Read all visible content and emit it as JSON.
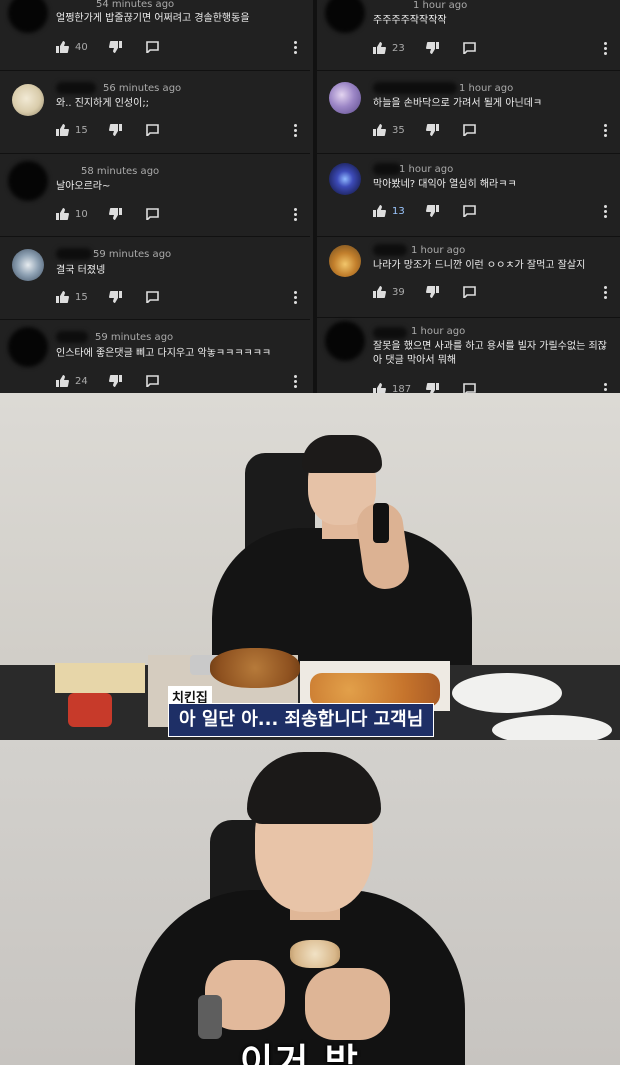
{
  "comments_left": [
    {
      "time": "54 minutes ago",
      "text": "얼쩡한가게 밥줄끊기면 어쩌려고 경솔한행동을",
      "likes": "40"
    },
    {
      "time": "56 minutes ago",
      "text": "와.. 진지하게 인성이;;",
      "likes": "15"
    },
    {
      "time": "58 minutes ago",
      "text": "날아오르라~",
      "likes": "10"
    },
    {
      "time": "59 minutes ago",
      "text": "결국 터졌넹",
      "likes": "15"
    },
    {
      "time": "59 minutes ago",
      "text": "인스타에 좋은댓글 삐고 다지우고 악놓ㅋㅋㅋㅋㅋㅋ",
      "likes": "24"
    }
  ],
  "comments_right": [
    {
      "time": "1 hour ago",
      "text": "주주주주작작작작",
      "likes": "23"
    },
    {
      "time": "1 hour ago",
      "text": "하늘을 손바닥으로 가려서 될게 아닌데ㅋ",
      "likes": "35"
    },
    {
      "time": "1 hour ago",
      "text": "막아봤네? 대익아 열심히 해라ㅋㅋ",
      "likes": "13"
    },
    {
      "time": "1 hour ago",
      "text": "나라가 망조가 드니깐 이런 ㅇㅇㅊ가 잘먹고 잘살지",
      "likes": "39"
    },
    {
      "time": "1 hour ago",
      "text": "잘못을 했으면 사과를 하고 용서를 빌자 가릴수없는 죄잖아 댓글 막아서 뭐해",
      "text2": "글 막아서 뭐해",
      "likes": "187"
    }
  ],
  "video1": {
    "speaker_label": "치킨집",
    "caption": "아 일단 아... 죄송합니다 고객님"
  },
  "video2": {
    "caption": "이거 받"
  },
  "colors": {
    "bg": "#212121",
    "caption_box": "#1e2f66",
    "liked_count": "#9cc7ff"
  }
}
